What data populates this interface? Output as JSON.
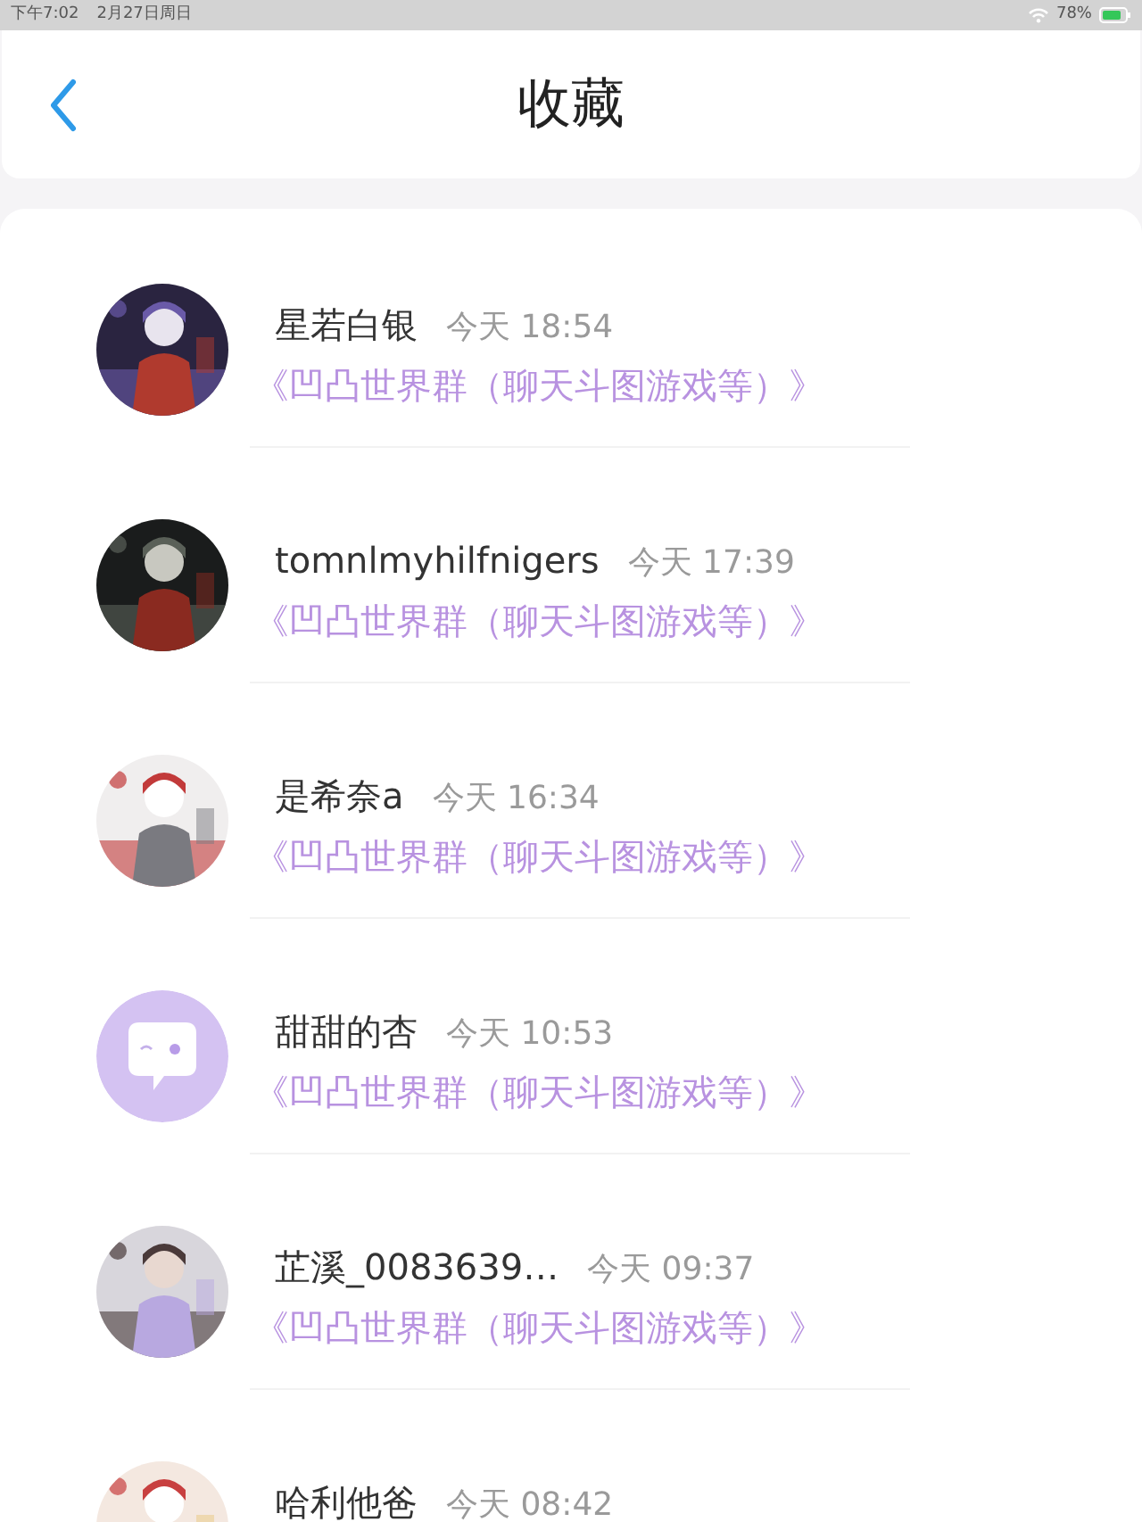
{
  "status_bar": {
    "time": "下午7:02",
    "date": "2月27日周日",
    "battery": "78%"
  },
  "header": {
    "title": "收藏"
  },
  "items": [
    {
      "name": "星若白银",
      "time": "今天 18:54",
      "group": "《凹凸世界群（聊天斗图游戏等）》"
    },
    {
      "name": "tomnlmyhilfnigers",
      "time": "今天 17:39",
      "group": "《凹凸世界群（聊天斗图游戏等）》"
    },
    {
      "name": "是希奈a",
      "time": "今天 16:34",
      "group": "《凹凸世界群（聊天斗图游戏等）》"
    },
    {
      "avatar": {
        "kind": "default"
      },
      "name": "甜甜的杏",
      "time": "今天 10:53",
      "group": "《凹凸世界群（聊天斗图游戏等）》"
    },
    {
      "name": "芷溪_0083639…",
      "time": "今天 09:37",
      "group": "《凹凸世界群（聊天斗图游戏等）》"
    },
    {
      "name": "哈利他爸",
      "time": "今天 08:42"
    }
  ]
}
